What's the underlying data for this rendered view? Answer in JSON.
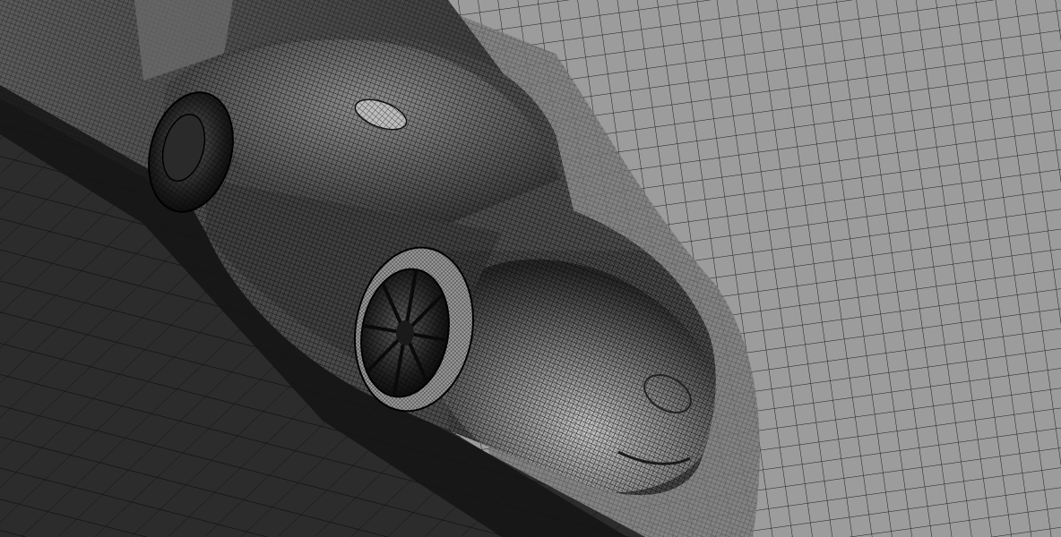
{
  "scene": {
    "subject": "car-surface-mesh",
    "style": "wireframe-mesh",
    "colors": {
      "background_plane": "#9a9a9a",
      "mesh_lines": "#000000",
      "ground_shadow": "#262626",
      "car_body_light": "#b4b4b4",
      "car_body_dark": "#3c3c3c",
      "tire": "#101010"
    }
  }
}
